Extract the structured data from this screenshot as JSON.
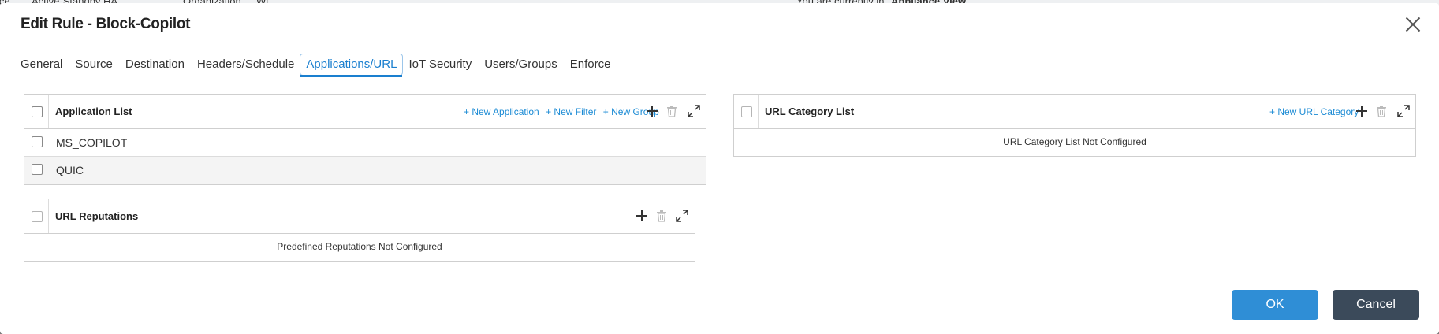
{
  "background": {
    "fragments": [
      "ice",
      "Active-Standby HA",
      "Organization",
      "Wi",
      "You are currently in",
      "Appliance View"
    ]
  },
  "dialog": {
    "title": "Edit Rule - Block-Copilot",
    "close_icon": "close-icon"
  },
  "tabs": [
    {
      "label": "General"
    },
    {
      "label": "Source"
    },
    {
      "label": "Destination"
    },
    {
      "label": "Headers/Schedule"
    },
    {
      "label": "Applications/URL",
      "active": true
    },
    {
      "label": "IoT Security"
    },
    {
      "label": "Users/Groups"
    },
    {
      "label": "Enforce"
    }
  ],
  "application_list": {
    "title": "Application List",
    "new_application": "+ New Application",
    "new_filter": "+ New Filter",
    "new_group": "+ New Group",
    "rows": [
      "MS_COPILOT",
      "QUIC"
    ]
  },
  "url_category_list": {
    "title": "URL Category List",
    "new_url_category": "+ New URL Category",
    "empty_message": "URL Category List Not Configured"
  },
  "url_reputations": {
    "title": "URL Reputations",
    "empty_message": "Predefined Reputations Not Configured"
  },
  "footer": {
    "ok_label": "OK",
    "cancel_label": "Cancel"
  },
  "colors": {
    "accent": "#1a7fcf",
    "link": "#1a8ad4",
    "ok_button": "#2f8ed6",
    "cancel_button": "#3b4a5a"
  }
}
